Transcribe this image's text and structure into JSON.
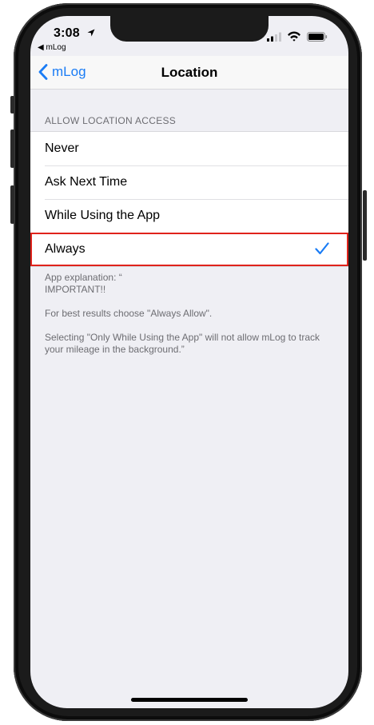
{
  "status_bar": {
    "time": "3:08",
    "back_app": "mLog",
    "back_glyph": "◀"
  },
  "nav": {
    "back_label": "mLog",
    "title": "Location"
  },
  "section": {
    "header": "ALLOW LOCATION ACCESS"
  },
  "options": [
    {
      "label": "Never"
    },
    {
      "label": "Ask Next Time"
    },
    {
      "label": "While Using the App"
    },
    {
      "label": "Always",
      "selected": true
    }
  ],
  "footer": {
    "line1": "App explanation: “",
    "line2": "IMPORTANT!!",
    "line3": "For best results choose \"Always Allow\".",
    "line4": "Selecting \"Only While Using the App\" will not allow mLog to track your mileage in the background.”"
  },
  "colors": {
    "accent": "#1a7cf5",
    "highlight_border": "#e0231c",
    "grouped_background": "#efeff4"
  },
  "icons": {
    "location_arrow": "location-arrow-icon",
    "signal": "signal-icon",
    "wifi": "wifi-icon",
    "battery": "battery-icon",
    "back_chevron": "chevron-left-icon",
    "checkmark": "checkmark-icon"
  }
}
